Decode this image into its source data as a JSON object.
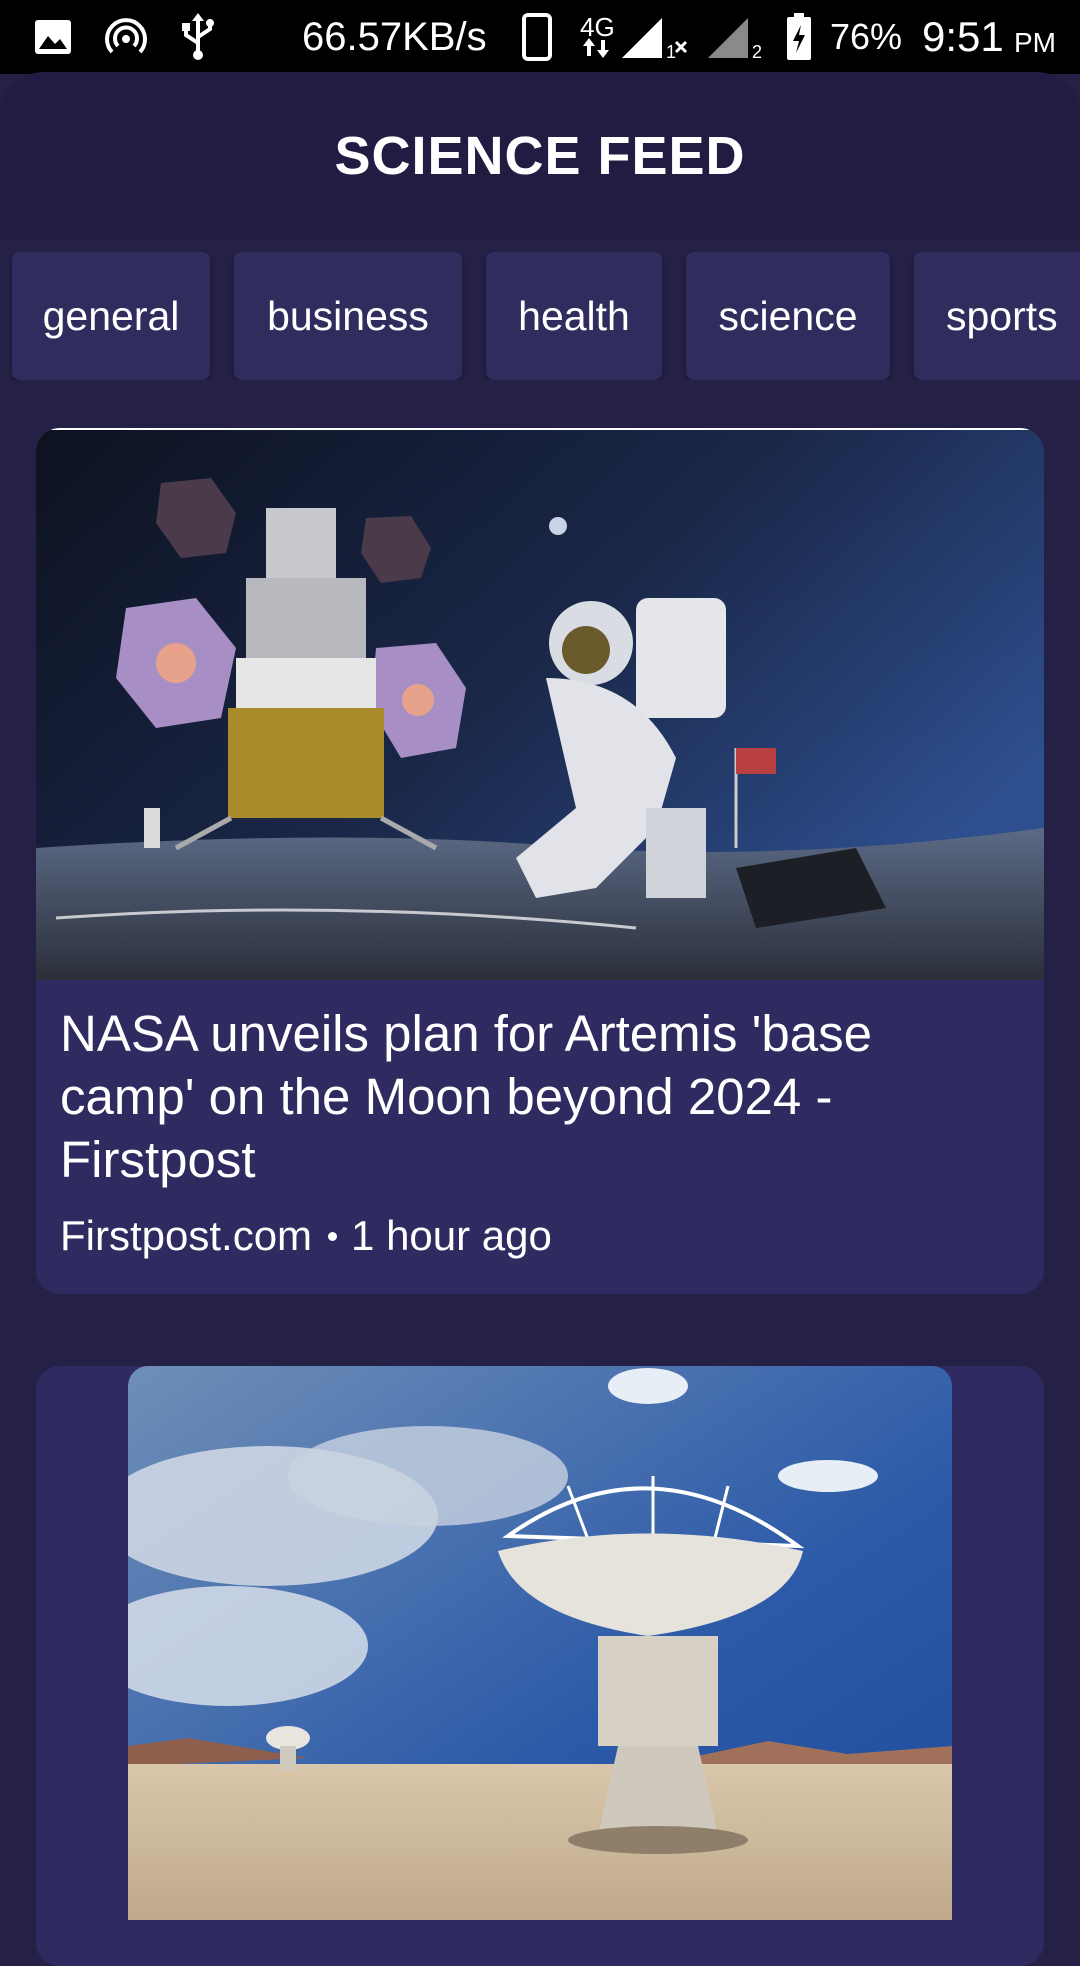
{
  "status_bar": {
    "net_speed": "66.57KB/s",
    "network_type": "4G",
    "sim1_label": "1",
    "sim2_label": "2",
    "battery": "76%",
    "time": "9:51",
    "ampm": "PM",
    "icons": [
      "image-icon",
      "hotspot-icon",
      "usb-icon",
      "phone-icon",
      "data-arrows-icon",
      "signal-icon",
      "signal-icon",
      "battery-charging-icon"
    ]
  },
  "header": {
    "title": "SCIENCE FEED"
  },
  "categories": [
    "general",
    "business",
    "health",
    "science",
    "sports"
  ],
  "articles": [
    {
      "title": "NASA unveils plan for Artemis 'base camp' on the Moon beyond 2024 - Firstpost",
      "source": "Firstpost.com",
      "time": "1 hour ago",
      "image": "astronaut-moon-lander-image"
    },
    {
      "title": "",
      "source": "",
      "time": "",
      "image": "radio-telescope-dish-image"
    }
  ],
  "colors": {
    "background": "#252046",
    "app_bar": "#211c42",
    "chip": "#302c5e",
    "card": "#2f2a5f",
    "text": "#ffffff"
  }
}
